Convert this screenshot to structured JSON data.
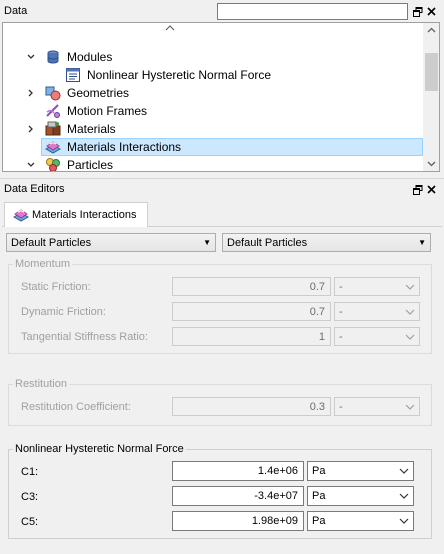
{
  "data_panel": {
    "title": "Data",
    "search_placeholder": "",
    "tree": [
      {
        "label": "Modules",
        "expander": "expanded",
        "icon": "database-icon",
        "level": 1
      },
      {
        "label": "Nonlinear Hysteretic Normal Force",
        "expander": "none",
        "icon": "document-list-icon",
        "level": 2
      },
      {
        "label": "Geometries",
        "expander": "collapsed",
        "icon": "geometries-icon",
        "level": 1
      },
      {
        "label": "Motion Frames",
        "expander": "none",
        "icon": "motion-frames-icon",
        "level": 1
      },
      {
        "label": "Materials",
        "expander": "collapsed",
        "icon": "materials-icon",
        "level": 1
      },
      {
        "label": "Materials Interactions",
        "expander": "none",
        "icon": "materials-interactions-icon",
        "level": 1,
        "selected": true
      },
      {
        "label": "Particles",
        "expander": "expanded",
        "icon": "particles-icon",
        "level": 1
      }
    ]
  },
  "editors_panel": {
    "title": "Data Editors",
    "tab_label": "Materials Interactions",
    "particle_a": "Default Particles",
    "particle_b": "Default Particles",
    "momentum": {
      "title": "Momentum",
      "rows": [
        {
          "label": "Static Friction:",
          "value": "0.7",
          "unit": "-"
        },
        {
          "label": "Dynamic Friction:",
          "value": "0.7",
          "unit": "-"
        },
        {
          "label": "Tangential Stiffness Ratio:",
          "value": "1",
          "unit": "-"
        }
      ]
    },
    "restitution": {
      "title": "Restitution",
      "rows": [
        {
          "label": "Restitution Coefficient:",
          "value": "0.3",
          "unit": "-"
        }
      ]
    },
    "nonlinear": {
      "title": "Nonlinear Hysteretic Normal Force",
      "rows": [
        {
          "label": "C1:",
          "value": "1.4e+06",
          "unit": "Pa"
        },
        {
          "label": "C3:",
          "value": "-3.4e+07",
          "unit": "Pa"
        },
        {
          "label": "C5:",
          "value": "1.98e+09",
          "unit": "Pa"
        }
      ]
    }
  }
}
